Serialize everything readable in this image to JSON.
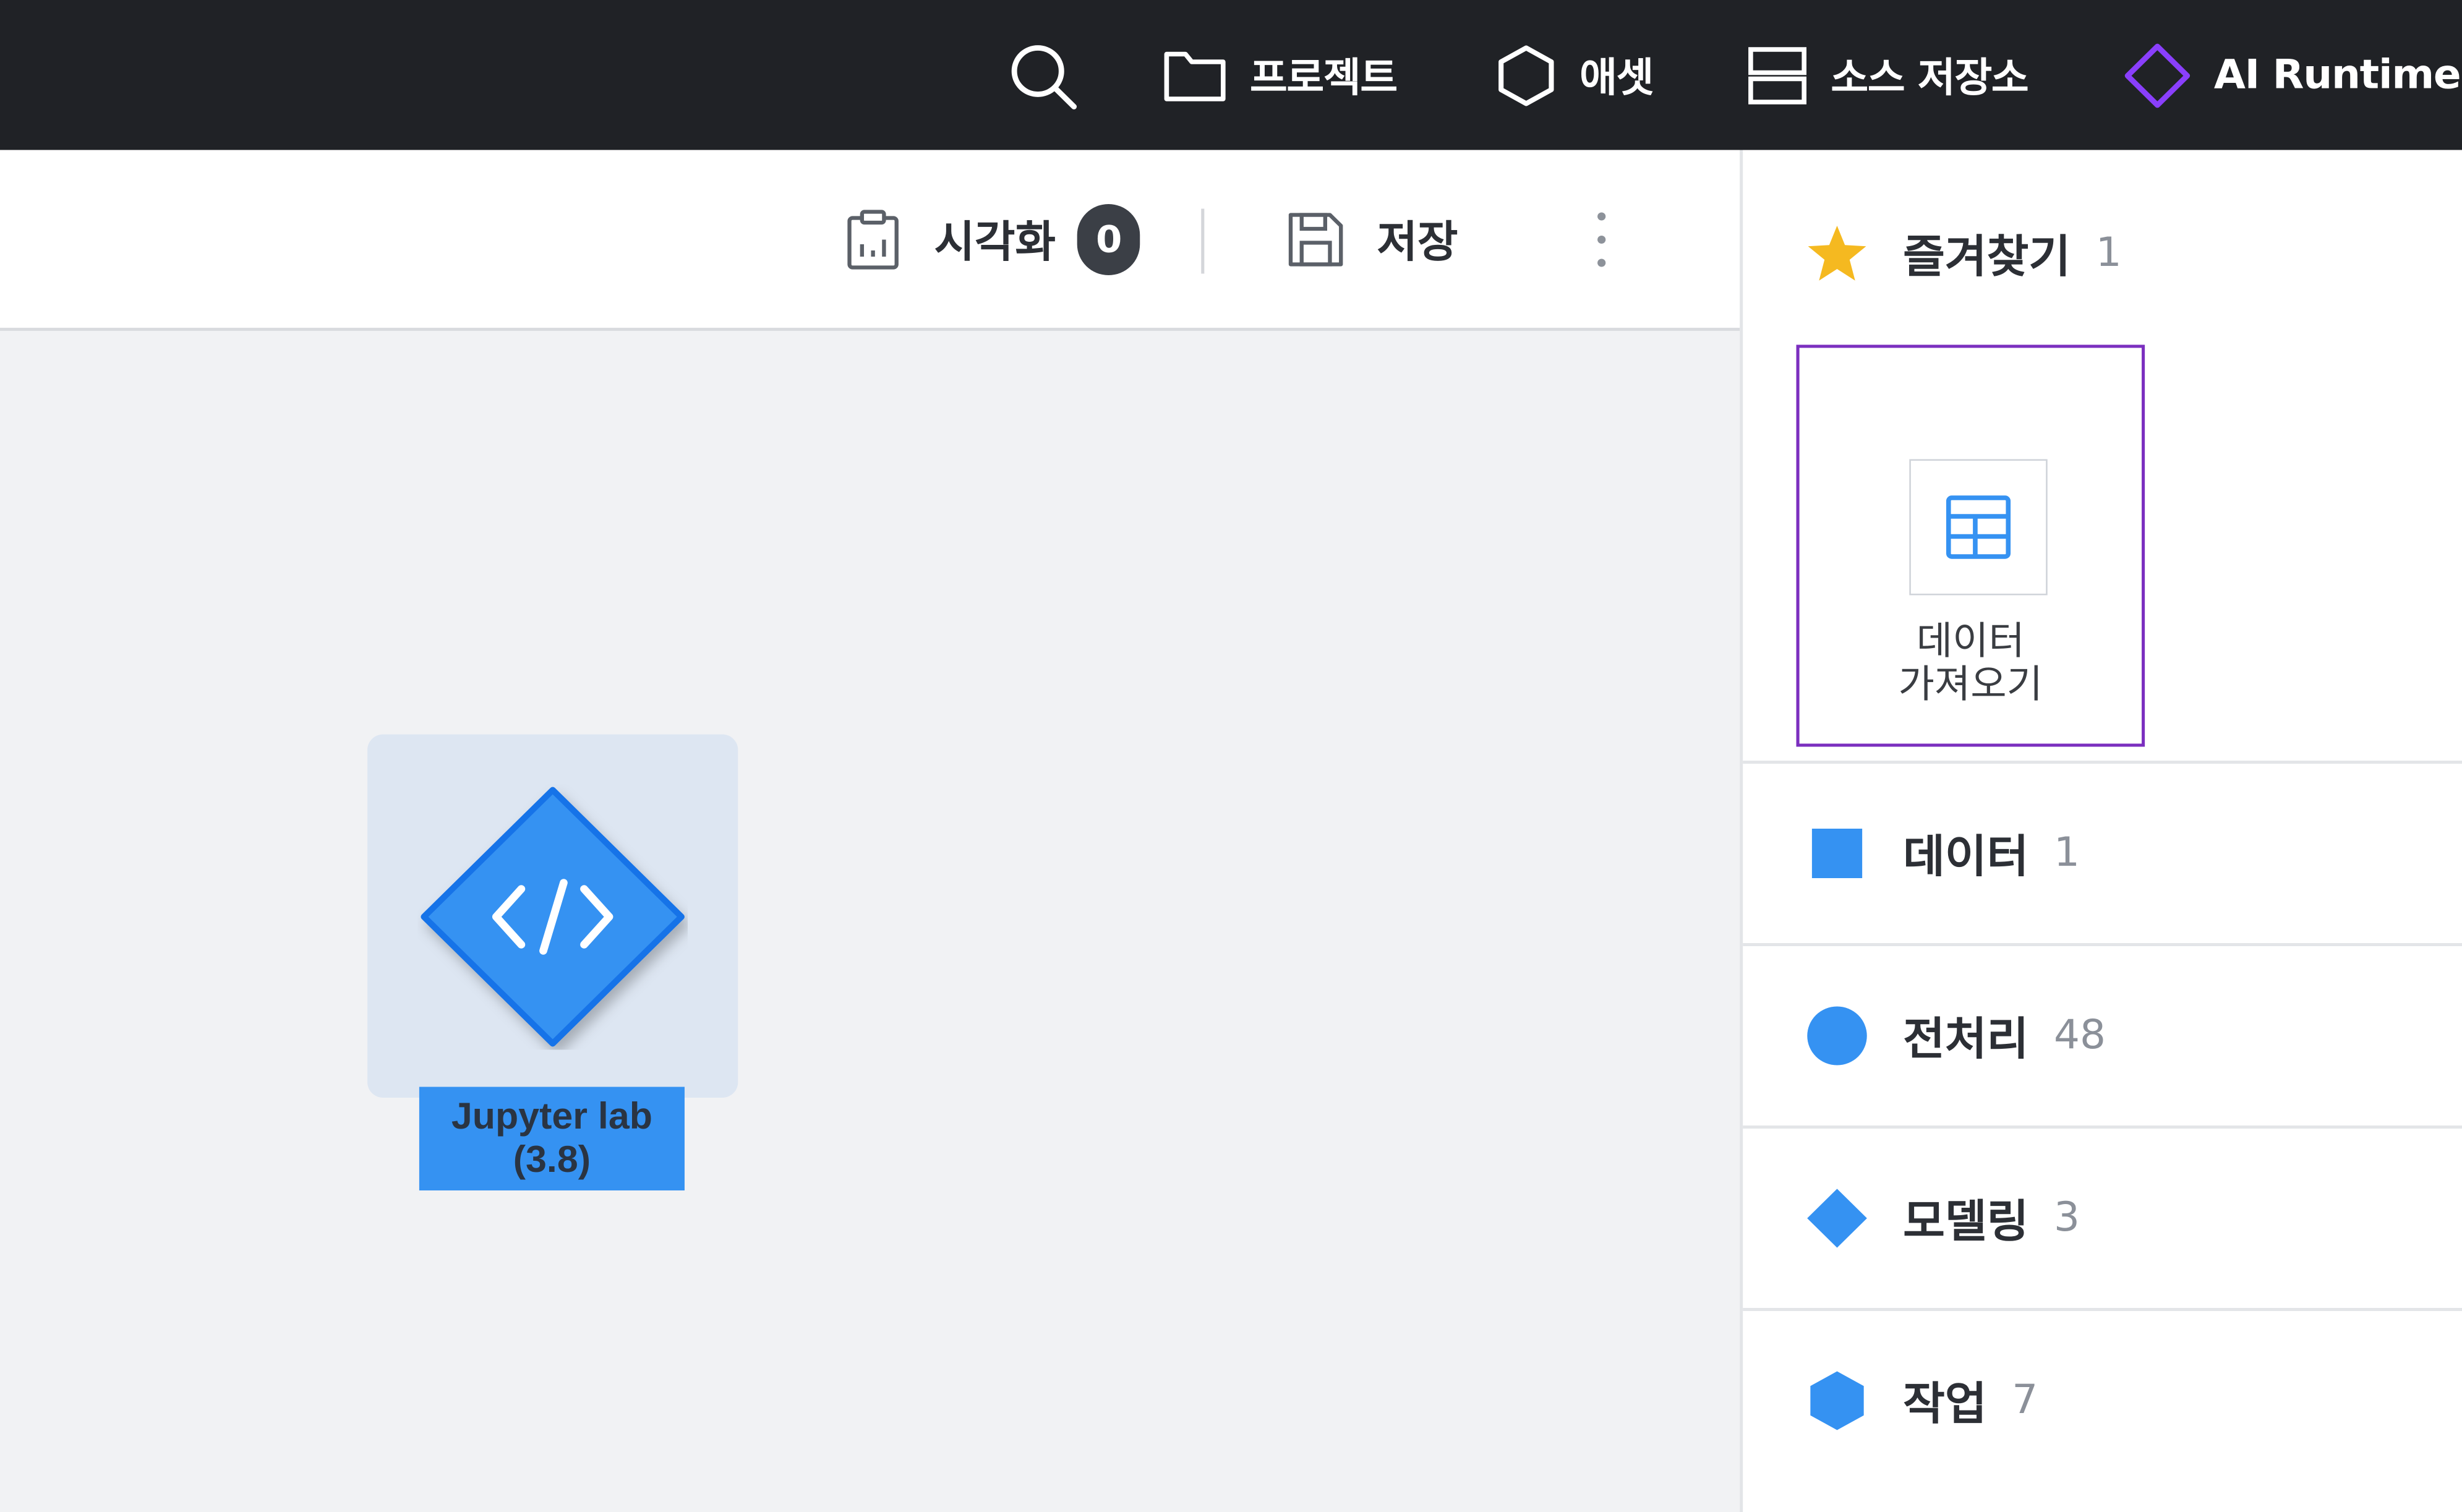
{
  "nav": {
    "search_icon": "search-icon",
    "project_label": "프로젝트",
    "asset_label": "애셋",
    "source_label": "소스 저장소",
    "runtime_label": "AI Runtime",
    "runtime_accent": "#8a3ffc"
  },
  "toolbar": {
    "visualize_label": "시각화",
    "visualize_count": "0",
    "save_label": "저장",
    "more_icon": "more-vertical-icon"
  },
  "canvas": {
    "node": {
      "name_line1": "Jupyter lab",
      "name_line2": "(3.8)",
      "icon": "code-icon",
      "color": "#3592f2"
    }
  },
  "panel": {
    "favorites": {
      "title": "즐겨찾기",
      "count": "1",
      "star_color": "#f5b920",
      "items": [
        {
          "line1": "데이터",
          "line2": "가져오기",
          "icon": "table-icon"
        }
      ]
    },
    "sections": [
      {
        "title": "데이터",
        "count": "1",
        "shape": "square",
        "color": "#3592f2"
      },
      {
        "title": "전처리",
        "count": "48",
        "shape": "circle",
        "color": "#3592f2"
      },
      {
        "title": "모델링",
        "count": "3",
        "shape": "diamond",
        "color": "#3592f2"
      },
      {
        "title": "작업",
        "count": "7",
        "shape": "hexagon",
        "color": "#3592f2"
      }
    ]
  }
}
